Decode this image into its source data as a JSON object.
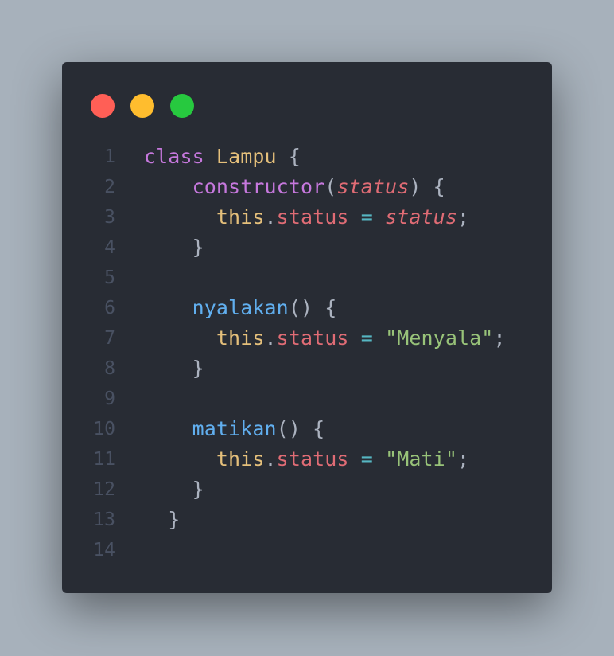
{
  "window_controls": {
    "close_color": "#ff5f56",
    "minimize_color": "#ffbd2e",
    "maximize_color": "#27c93f"
  },
  "colors": {
    "keyword": "#c678dd",
    "class": "#e5c07b",
    "prop": "#e06c75",
    "op": "#56b6c2",
    "func": "#61afef",
    "string": "#98c379",
    "punct": "#abb2bf"
  },
  "lines": [
    {
      "n": "1",
      "tokens": [
        {
          "t": "class ",
          "c": "keyword"
        },
        {
          "t": "Lampu",
          "c": "class"
        },
        {
          "t": " {",
          "c": "punct"
        }
      ]
    },
    {
      "n": "2",
      "tokens": [
        {
          "t": "    constructor",
          "c": "keyword"
        },
        {
          "t": "(",
          "c": "punct"
        },
        {
          "t": "status",
          "c": "prop",
          "i": true
        },
        {
          "t": ") {",
          "c": "punct"
        }
      ]
    },
    {
      "n": "3",
      "tokens": [
        {
          "t": "      this",
          "c": "class"
        },
        {
          "t": ".",
          "c": "punct"
        },
        {
          "t": "status",
          "c": "prop"
        },
        {
          "t": " = ",
          "c": "op"
        },
        {
          "t": "status",
          "c": "prop",
          "i": true
        },
        {
          "t": ";",
          "c": "punct"
        }
      ]
    },
    {
      "n": "4",
      "tokens": [
        {
          "t": "    }",
          "c": "punct"
        }
      ]
    },
    {
      "n": "5",
      "tokens": []
    },
    {
      "n": "6",
      "tokens": [
        {
          "t": "    nyalakan",
          "c": "func"
        },
        {
          "t": "() {",
          "c": "punct"
        }
      ]
    },
    {
      "n": "7",
      "tokens": [
        {
          "t": "      this",
          "c": "class"
        },
        {
          "t": ".",
          "c": "punct"
        },
        {
          "t": "status",
          "c": "prop"
        },
        {
          "t": " = ",
          "c": "op"
        },
        {
          "t": "\"Menyala\"",
          "c": "string"
        },
        {
          "t": ";",
          "c": "punct"
        }
      ]
    },
    {
      "n": "8",
      "tokens": [
        {
          "t": "    }",
          "c": "punct"
        }
      ]
    },
    {
      "n": "9",
      "tokens": []
    },
    {
      "n": "10",
      "tokens": [
        {
          "t": "    matikan",
          "c": "func"
        },
        {
          "t": "() {",
          "c": "punct"
        }
      ]
    },
    {
      "n": "11",
      "tokens": [
        {
          "t": "      this",
          "c": "class"
        },
        {
          "t": ".",
          "c": "punct"
        },
        {
          "t": "status",
          "c": "prop"
        },
        {
          "t": " = ",
          "c": "op"
        },
        {
          "t": "\"Mati\"",
          "c": "string"
        },
        {
          "t": ";",
          "c": "punct"
        }
      ]
    },
    {
      "n": "12",
      "tokens": [
        {
          "t": "    }",
          "c": "punct"
        }
      ]
    },
    {
      "n": "13",
      "tokens": [
        {
          "t": "  }",
          "c": "punct"
        }
      ]
    },
    {
      "n": "14",
      "tokens": []
    }
  ]
}
